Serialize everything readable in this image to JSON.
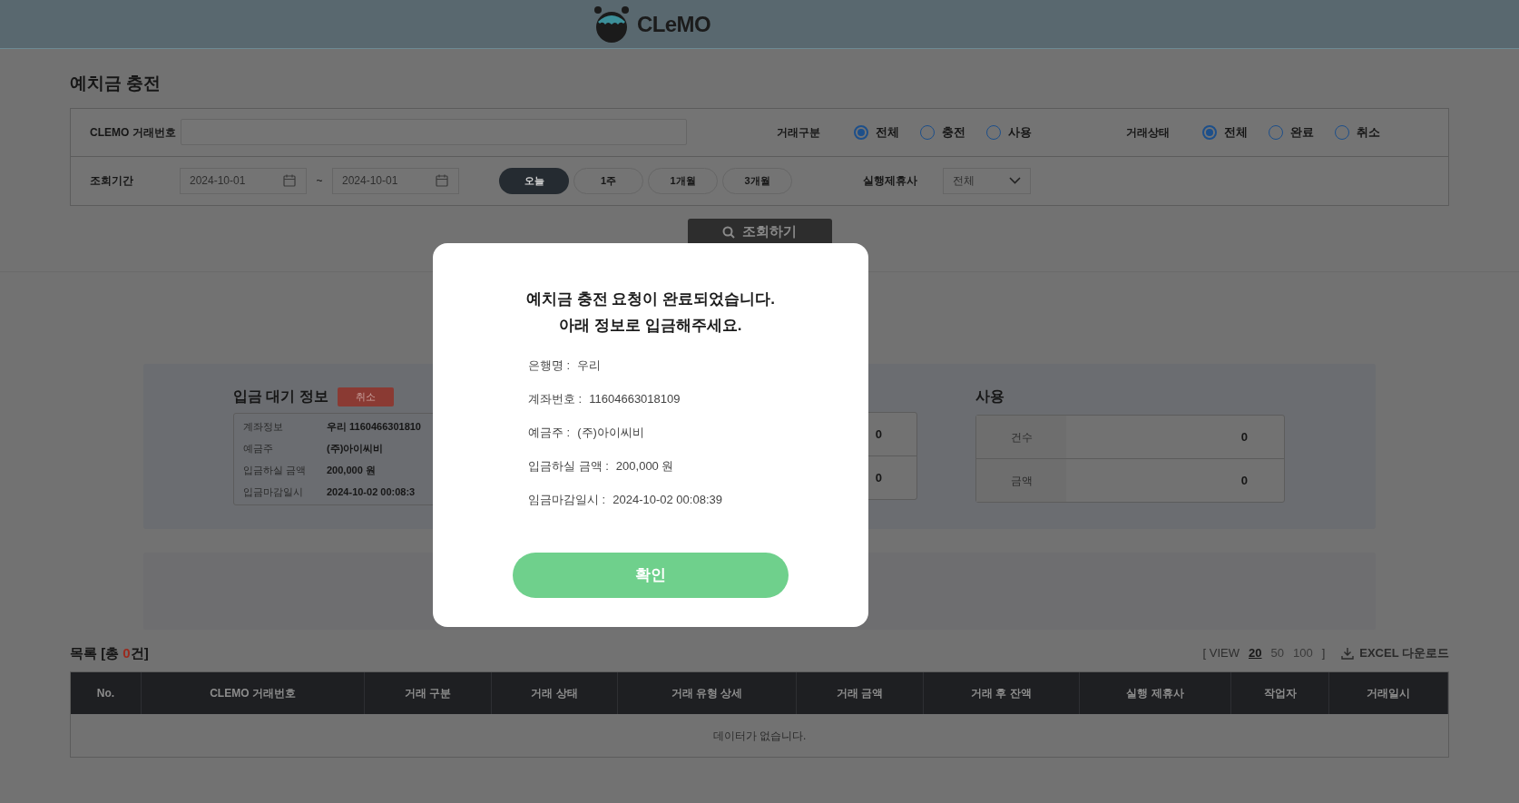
{
  "header": {
    "logo_text": "CLeMO"
  },
  "page_title": "예치금 충전",
  "filters": {
    "txn_no": {
      "label": "CLEMO 거래번호"
    },
    "txn_type": {
      "label": "거래구분",
      "options": [
        {
          "label": "전체",
          "selected": true
        },
        {
          "label": "충전",
          "selected": false
        },
        {
          "label": "사용",
          "selected": false
        }
      ]
    },
    "txn_status": {
      "label": "거래상태",
      "options": [
        {
          "label": "전체",
          "selected": true
        },
        {
          "label": "완료",
          "selected": false
        },
        {
          "label": "취소",
          "selected": false
        }
      ]
    },
    "period": {
      "label": "조회기간",
      "from": "2024-10-01",
      "separator": "~",
      "to": "2024-10-01",
      "presets": [
        {
          "label": "오늘",
          "selected": true
        },
        {
          "label": "1주",
          "selected": false
        },
        {
          "label": "1개월",
          "selected": false
        },
        {
          "label": "3개월",
          "selected": false
        }
      ]
    },
    "partner": {
      "label": "실행제휴사",
      "value": "전체"
    }
  },
  "search_button": "조회하기",
  "pending": {
    "title": "입금 대기 정보",
    "cancel": "취소",
    "rows": [
      {
        "label": "계좌정보",
        "value": "우리 1160466301810"
      },
      {
        "label": "예금주",
        "value": "(주)아이씨비"
      },
      {
        "label": "입금하실 금액",
        "value": "200,000 원"
      },
      {
        "label": "입금마감일시",
        "value": "2024-10-02 00:08:3"
      }
    ]
  },
  "charge_stats": {
    "rows": [
      {
        "value": "0"
      },
      {
        "value": "0"
      }
    ]
  },
  "usage_stats": {
    "title": "사용",
    "rows": [
      {
        "label": "건수",
        "value": "0"
      },
      {
        "label": "금액",
        "value": "0"
      }
    ]
  },
  "list": {
    "title_before": "목록 [총 ",
    "count": "0",
    "title_after": "건]",
    "view_label": "[ VIEW",
    "view_options": [
      {
        "label": "20",
        "selected": true
      },
      {
        "label": "50",
        "selected": false
      },
      {
        "label": "100",
        "selected": false
      }
    ],
    "view_close": "]",
    "excel": "EXCEL 다운로드",
    "columns": [
      "No.",
      "CLEMO 거래번호",
      "거래 구분",
      "거래 상태",
      "거래 유형 상세",
      "거래 금액",
      "거래 후 잔액",
      "실행 제휴사",
      "작업자",
      "거래일시"
    ],
    "empty": "데이터가 없습니다."
  },
  "modal": {
    "title_lines": [
      "예치금 충전 요청이 완료되었습니다.",
      "아래 정보로 입금해주세요."
    ],
    "fields": [
      {
        "label": "은행명 :",
        "value": "우리"
      },
      {
        "label": "계좌번호 :",
        "value": "11604663018109"
      },
      {
        "label": "예금주 :",
        "value": "(주)아이씨비"
      },
      {
        "label": "입금하실 금액 :",
        "value": "200,000 원"
      },
      {
        "label": "임금마감일시 :",
        "value": "2024-10-02 00:08:39"
      }
    ],
    "confirm": "확인"
  }
}
